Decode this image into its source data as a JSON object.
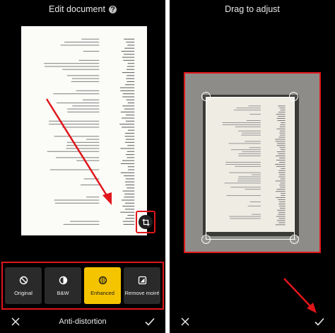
{
  "left_screen": {
    "title": "Edit document",
    "filters": [
      {
        "label": "Original",
        "icon": "no-filter-icon",
        "selected": false
      },
      {
        "label": "B&W",
        "icon": "contrast-icon",
        "selected": false
      },
      {
        "label": "Enhanced",
        "icon": "enhance-icon",
        "selected": true
      },
      {
        "label": "Remove moiré",
        "icon": "remove-moire-icon",
        "selected": false
      }
    ],
    "bottom_title": "Anti-distortion",
    "close_icon": "close-icon",
    "confirm_icon": "checkmark-icon",
    "crop_icon": "crop-icon"
  },
  "right_screen": {
    "title": "Drag to adjust",
    "close_icon": "close-icon",
    "confirm_icon": "checkmark-icon"
  },
  "colors": {
    "highlight_red": "#e0161b",
    "selected_yellow": "#f5c400",
    "panel_bg": "#000000",
    "tile_bg": "#2a2a2a"
  }
}
